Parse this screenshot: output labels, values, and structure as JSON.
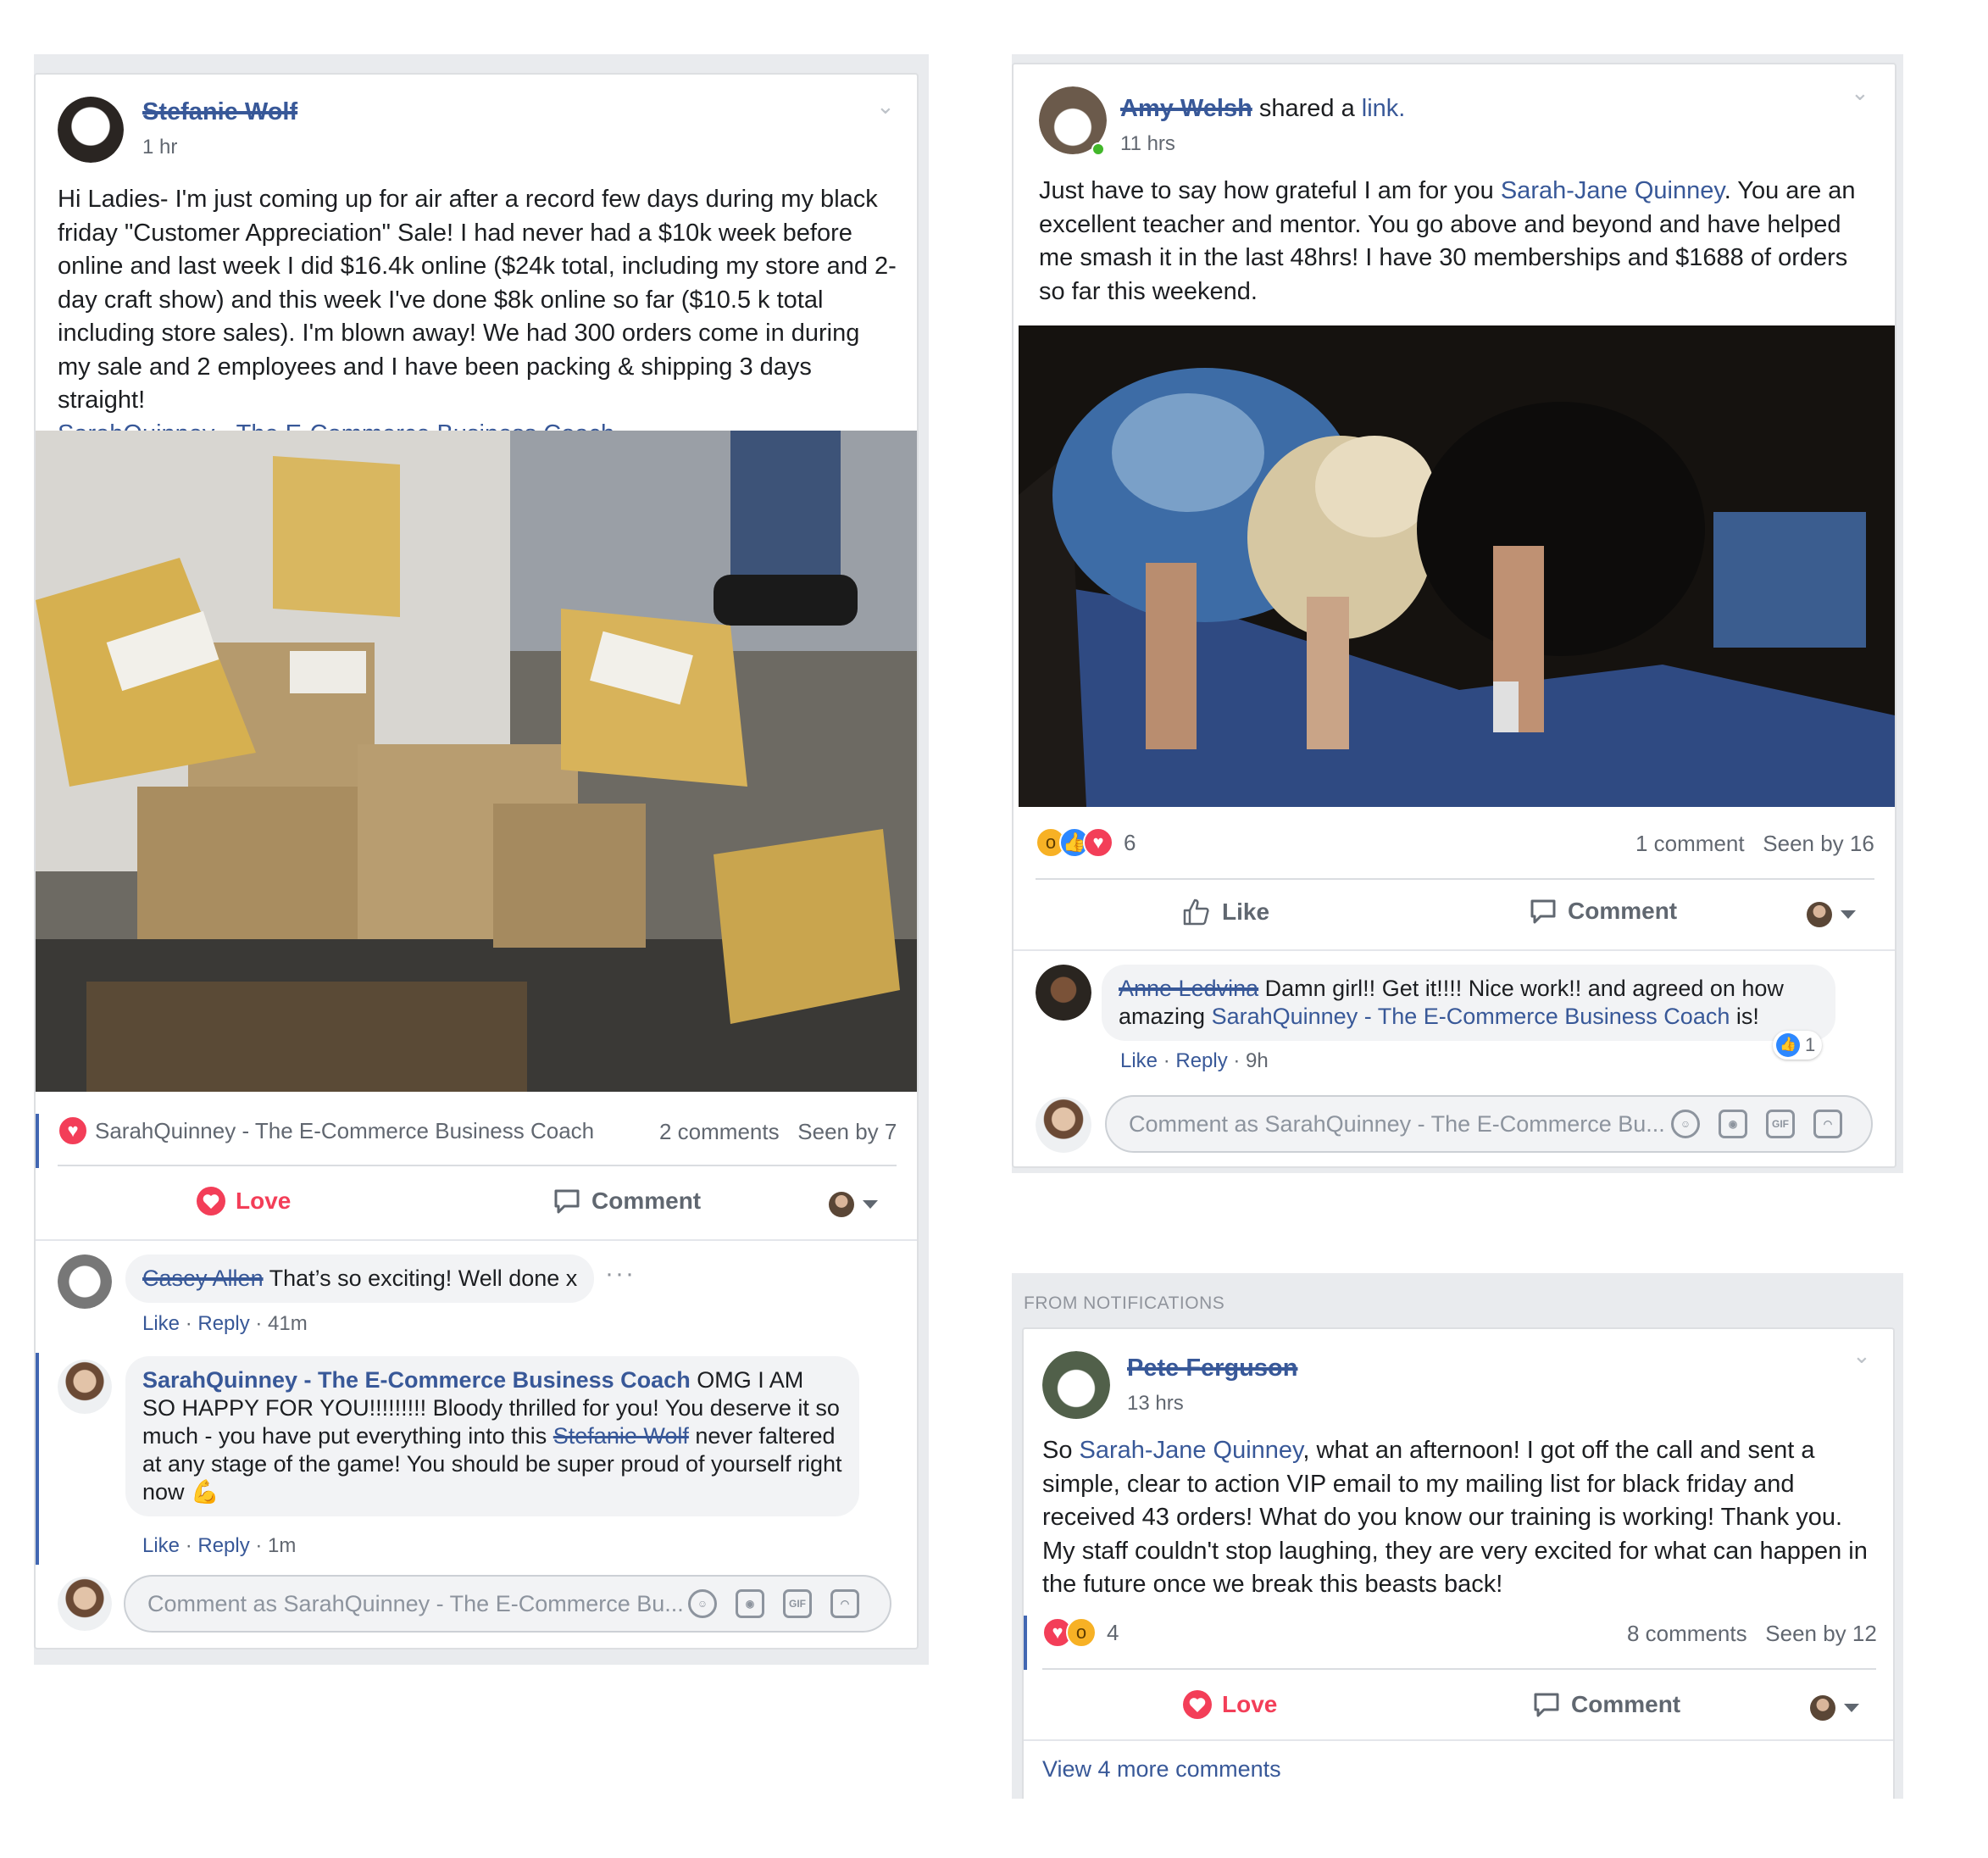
{
  "post1": {
    "author": "Stefanie Wolf",
    "time": "1 hr",
    "text": "Hi Ladies- I'm just coming up for air after a record few days during my black friday \"Customer Appreciation\" Sale! I had never had a $10k week before online and last week I did $16.4k online ($24k total, including my store and 2-day craft show) and this week I've done $8k online so far ($10.5 k total including store sales). I'm blown away! We had 300 orders come in during my sale and 2 employees and I have been packing & shipping 3 days straight!",
    "tag": "SarahQuinney - The E-Commerce Business Coach",
    "reaction_by": "SarahQuinney - The E-Commerce Business Coach",
    "comments_count": "2 comments",
    "seen_by": "Seen by 7",
    "action_love": "Love",
    "action_comment": "Comment",
    "comment1": {
      "author": "Casey Allen",
      "text": "That’s so exciting! Well done x",
      "like": "Like",
      "reply": "Reply",
      "time": "41m"
    },
    "comment2": {
      "author": "SarahQuinney - The E-Commerce Business Coach",
      "text_a": "OMG I AM SO HAPPY FOR YOU!!!!!!!!! Bloody thrilled for you! You deserve it so much - you have put everything into this",
      "strike": "Stefanie Wolf",
      "text_b": "never faltered at any stage of the game! You should be super proud of yourself right now",
      "emoji": "💪",
      "like": "Like",
      "reply": "Reply",
      "time": "1m"
    },
    "input_placeholder": "Comment as SarahQuinney - The E-Commerce Bu..."
  },
  "post2": {
    "author": "Amy Welsh",
    "shared": "shared a",
    "link_word": "link.",
    "time": "11 hrs",
    "text_a": "Just have to say how grateful I am for you",
    "mention": "Sarah-Jane Quinney",
    "text_b": ". You are an excellent teacher and mentor. You go above and beyond and have helped me smash it in the last 48hrs! I have 30 memberships and $1688 of orders so far this weekend.",
    "reaction_count": "6",
    "comments_count": "1 comment",
    "seen_by": "Seen by 16",
    "action_like": "Like",
    "action_comment": "Comment",
    "comment1": {
      "author": "Anne Ledvina",
      "text_a": "Damn girl!! Get it!!!! Nice work!! and agreed on how amazing",
      "mention": "SarahQuinney - The E-Commerce Business Coach",
      "text_b": "is!",
      "like": "Like",
      "reply": "Reply",
      "time": "9h",
      "likes": "1"
    },
    "input_placeholder": "Comment as SarahQuinney - The E-Commerce Bu..."
  },
  "post3": {
    "from_label": "FROM NOTIFICATIONS",
    "author": "Pete Ferguson",
    "time": "13 hrs",
    "text_a": "So",
    "mention": "Sarah-Jane Quinney",
    "text_b": ", what an afternoon! I got off the call and sent a simple, clear to action VIP email to my mailing list for black friday and received 43 orders! What do you know our training is working! Thank you. My staff couldn't stop laughing, they are very excited for what can happen in the future once we break this beasts back!",
    "reaction_count": "4",
    "comments_count": "8 comments",
    "seen_by": "Seen by 12",
    "action_love": "Love",
    "action_comment": "Comment",
    "more_comments": "View 4 more comments"
  },
  "colors": {
    "link": "#385898",
    "love": "#f33e58",
    "like": "#2d88ff",
    "panel": "#e9ebee"
  }
}
